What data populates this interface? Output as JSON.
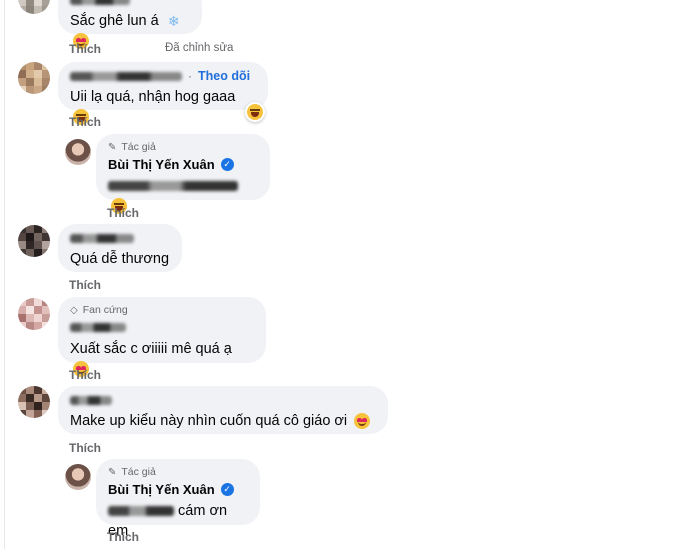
{
  "comments": [
    {
      "text": "Sắc ghê lun á",
      "like_label": "Thích",
      "edited_label": "Đã chỉnh sửa",
      "emojis": [
        "snowflake-icon",
        "heart-eyes-emoji"
      ]
    },
    {
      "follow_label": "Theo dõi",
      "text": "Uii lạ quá, nhận hog gaaa",
      "like_label": "Thích",
      "emojis": [
        "laughing-emoji",
        "laughing-reaction"
      ]
    },
    {
      "author_badge": "Tác giả",
      "author_name": "Bùi Thị Yến Xuân",
      "like_label": "Thích",
      "emojis": [
        "laughing-emoji"
      ]
    },
    {
      "text": "Quá dễ thương",
      "like_label": "Thích"
    },
    {
      "fan_badge": "Fan cứng",
      "text": "Xuất sắc c ơiiiii mê quá ạ",
      "like_label": "Thích",
      "emojis": [
        "heart-eyes-emoji"
      ]
    },
    {
      "text": "Make up kiểu này nhìn cuốn quá cô giáo ơi",
      "like_label": "Thích",
      "emojis": [
        "heart-eyes-emoji"
      ]
    },
    {
      "author_badge": "Tác giả",
      "author_name": "Bùi Thị Yến Xuân",
      "text": "cám ơn em",
      "like_label": "Thích"
    }
  ],
  "colors": {
    "bubble_bg": "#f0f2f5",
    "link_blue": "#216fdb",
    "verified_blue": "#1b74e4",
    "muted_text": "#65676b"
  }
}
